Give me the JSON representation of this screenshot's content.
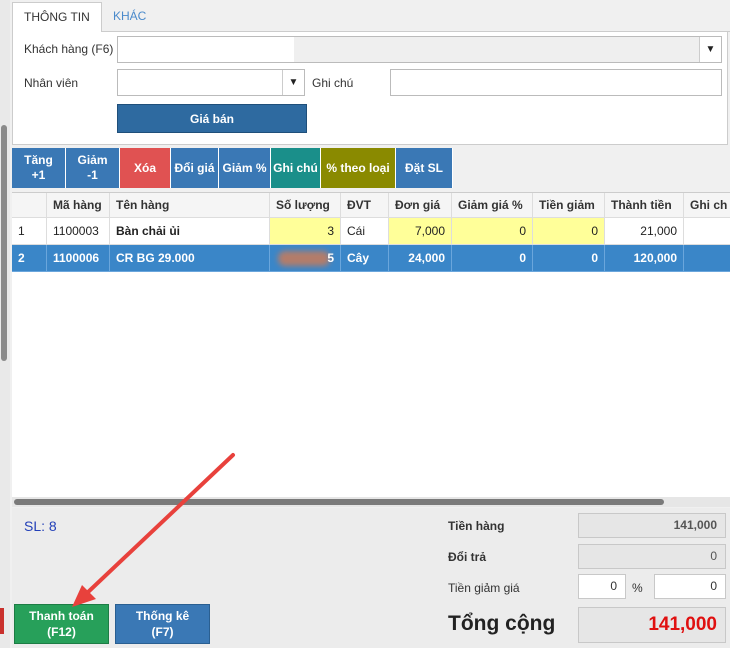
{
  "tabs": {
    "info": "THÔNG TIN",
    "other": "KHÁC"
  },
  "form": {
    "customer_label": "Khách hàng (F6)",
    "employee_label": "Nhân viên",
    "note_label": "Ghi chú",
    "price_button": "Giá bán"
  },
  "toolbar": {
    "inc_line1": "Tăng",
    "inc_line2": "+1",
    "dec_line1": "Giảm",
    "dec_line2": "-1",
    "delete": "Xóa",
    "change_price": "Đổi giá",
    "discount_pct": "Giảm %",
    "note": "Ghi chú",
    "pct_by_type": "% theo loại",
    "set_qty": "Đặt SL"
  },
  "grid": {
    "headers": [
      "Mã hàng",
      "Tên hàng",
      "Số lượng",
      "ĐVT",
      "Đơn giá",
      "Giảm giá %",
      "Tiền giảm",
      "Thành tiền",
      "Ghi ch"
    ],
    "rows": [
      {
        "no": "1",
        "code": "1100003",
        "name": "Bàn chải ủi",
        "qty": "3",
        "unit": "Cái",
        "price": "7,000",
        "disc_pct": "0",
        "disc_amt": "0",
        "total": "21,000"
      },
      {
        "no": "2",
        "code": "1100006",
        "name": "CR BG 29.000",
        "qty": "5",
        "unit": "Cây",
        "price": "24,000",
        "disc_pct": "0",
        "disc_amt": "0",
        "total": "120,000"
      }
    ]
  },
  "footer": {
    "qty_count": "SL: 8",
    "goods_label": "Tiền hàng",
    "goods_value": "141,000",
    "return_label": "Đổi trả",
    "return_value": "0",
    "discount_label": "Tiền giảm giá",
    "discount_pct_value": "0",
    "pct_sign": "%",
    "discount_value": "0",
    "total_label": "Tổng cộng",
    "total_value": "141,000",
    "pay_line1": "Thanh toán",
    "pay_line2": "(F12)",
    "stats_line1": "Thống kê",
    "stats_line2": "(F7)"
  },
  "colors": {
    "blue": "#3a78b5",
    "red": "#e05252",
    "teal": "#1a8f8a",
    "olive": "#8a8a00",
    "green": "#27a05a",
    "total_red": "#e01010"
  },
  "icons": {
    "dropdown": "chevron-down-icon",
    "annotation": "red-arrow"
  }
}
